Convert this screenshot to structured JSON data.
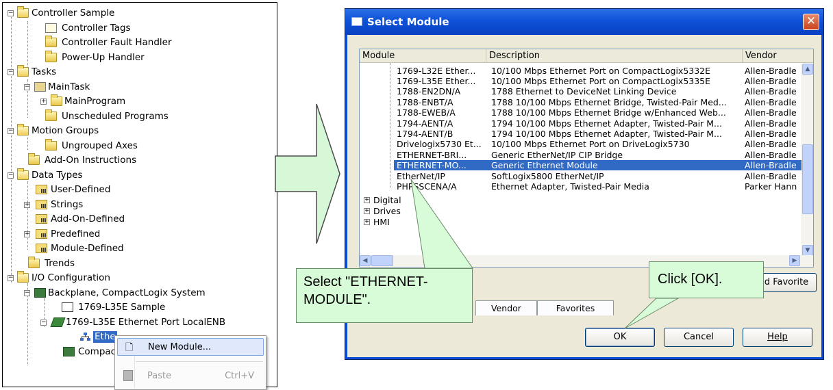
{
  "tree": {
    "items": [
      {
        "label": "Controller Sample"
      },
      {
        "label": "Controller Tags"
      },
      {
        "label": "Controller Fault Handler"
      },
      {
        "label": "Power-Up Handler"
      },
      {
        "label": "Tasks"
      },
      {
        "label": "MainTask"
      },
      {
        "label": "MainProgram"
      },
      {
        "label": "Unscheduled Programs"
      },
      {
        "label": "Motion Groups"
      },
      {
        "label": "Ungrouped Axes"
      },
      {
        "label": "Add-On Instructions"
      },
      {
        "label": "Data Types"
      },
      {
        "label": "User-Defined"
      },
      {
        "label": "Strings"
      },
      {
        "label": "Add-On-Defined"
      },
      {
        "label": "Predefined"
      },
      {
        "label": "Module-Defined"
      },
      {
        "label": "Trends"
      },
      {
        "label": "I/O Configuration"
      },
      {
        "label": "Backplane, CompactLogix System"
      },
      {
        "label": "1769-L35E Sample"
      },
      {
        "label": "1769-L35E Ethernet Port LocalENB"
      },
      {
        "label": "Ethe"
      },
      {
        "label": "Compac"
      }
    ]
  },
  "context_menu": {
    "new_module": "New Module...",
    "paste": "Paste",
    "paste_shortcut": "Ctrl+V"
  },
  "dialog": {
    "title": "Select Module",
    "close": "✕",
    "columns": [
      "Module",
      "Description",
      "Vendor"
    ],
    "rows": [
      {
        "module": "1769-L32E Ether...",
        "description": "10/100 Mbps Ethernet Port on CompactLogix5332E",
        "vendor": "Allen-Bradle"
      },
      {
        "module": "1769-L35E Ether...",
        "description": "10/100 Mbps Ethernet Port on CompactLogix5335E",
        "vendor": "Allen-Bradle"
      },
      {
        "module": "1788-EN2DN/A",
        "description": "1788 Ethernet to DeviceNet Linking Device",
        "vendor": "Allen-Bradle"
      },
      {
        "module": "1788-ENBT/A",
        "description": "1788 10/100 Mbps Ethernet Bridge, Twisted-Pair Med...",
        "vendor": "Allen-Bradle"
      },
      {
        "module": "1788-EWEB/A",
        "description": "1788 10/100 Mbps Ethernet Bridge w/Enhanced Web...",
        "vendor": "Allen-Bradle"
      },
      {
        "module": "1794-AENT/A",
        "description": "1794 10/100 Mbps Ethernet Adapter, Twisted-Pair M...",
        "vendor": "Allen-Bradle"
      },
      {
        "module": "1794-AENT/B",
        "description": "1794 10/100 Mbps Ethernet Adapter, Twisted-Pair M...",
        "vendor": "Allen-Bradle"
      },
      {
        "module": "Drivelogix5730 Et...",
        "description": "10/100 Mbps Ethernet Port on DriveLogix5730",
        "vendor": "Allen-Bradle"
      },
      {
        "module": "ETHERNET-BRI...",
        "description": "Generic EtherNet/IP CIP Bridge",
        "vendor": "Allen-Bradle"
      },
      {
        "module": "ETHERNET-MO...",
        "description": "Generic Ethernet Module",
        "vendor": "Allen-Bradle"
      },
      {
        "module": "EtherNet/IP",
        "description": "SoftLogix5800 EtherNet/IP",
        "vendor": "Allen-Bradle"
      },
      {
        "module": "PHPSSCENA/A",
        "description": "Ethernet Adapter, Twisted-Pair Media",
        "vendor": "Parker Hann"
      }
    ],
    "groups": [
      "Digital",
      "Drives",
      "HMI"
    ],
    "add_favorite": "d Favorite",
    "tabs": [
      "Vendor",
      "Favorites"
    ],
    "ok": "OK",
    "cancel": "Cancel",
    "help": "Help"
  },
  "callouts": {
    "select": "Select \"ETHERNET-MODULE\".",
    "click_ok": "Click [OK]."
  },
  "colors": {
    "selection": "#316ac5",
    "callout_fill": "#d8fbd8",
    "titlebar": "#0f52d8"
  }
}
